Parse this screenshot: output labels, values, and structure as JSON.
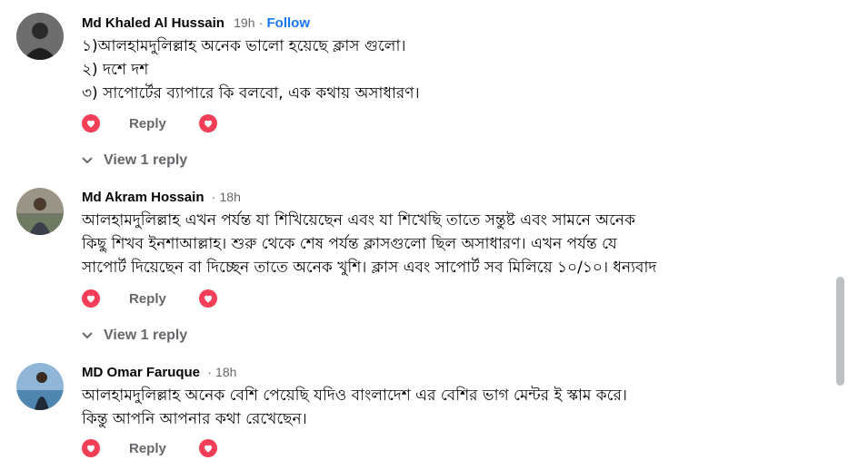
{
  "comments": [
    {
      "author": "Md Khaled Al Hussain",
      "time": "19h",
      "separator": "·",
      "follow": "Follow",
      "text": "১)আলহামদুলিল্লাহ অনেক ভালো হয়েছে ক্লাস গুলো।\n২) দশে দশ\n৩) সাপোর্টের ব্যাপারে কি বলবো, এক কথায় অসাধারণ।",
      "reply": "Reply",
      "view_replies": "View 1 reply"
    },
    {
      "author": "Md Akram Hossain",
      "time": "18h",
      "separator": "·",
      "text": "আলহামদুলিল্লাহ এখন পর্যন্ত যা শিখিয়েছেন এবং যা শিখেছি তাতে সন্তুষ্ট এবং সামনে অনেক\nকিছু শিখব ইনশাআল্লাহ। শুরু থেকে শেষ পর্যন্ত ক্লাসগুলো ছিল অসাধারণ। এখন পর্যন্ত যে\nসাপোর্ট দিয়েছেন বা দিচ্ছেন তাতে অনেক খুশি। ক্লাস এবং সাপোর্ট সব মিলিয়ে ১০/১০। ধন্যবাদ",
      "reply": "Reply",
      "view_replies": "View 1 reply"
    },
    {
      "author": "MD Omar Faruque",
      "time": "18h",
      "separator": "·",
      "text": "আলহামদুলিল্লাহ অনেক বেশি পেয়েছি যদিও বাংলাদেশ এর বেশির ভাগ মেন্টর ই স্কাম করে।\nকিন্তু আপনি আপনার কথা রেখেছেন।",
      "reply": "Reply"
    }
  ],
  "icons": {
    "reaction": "heart-icon",
    "expand": "chevron-down-icon"
  },
  "colors": {
    "love_reaction": "#f33e58",
    "link": "#1877f2",
    "secondary_text": "#65676b"
  }
}
